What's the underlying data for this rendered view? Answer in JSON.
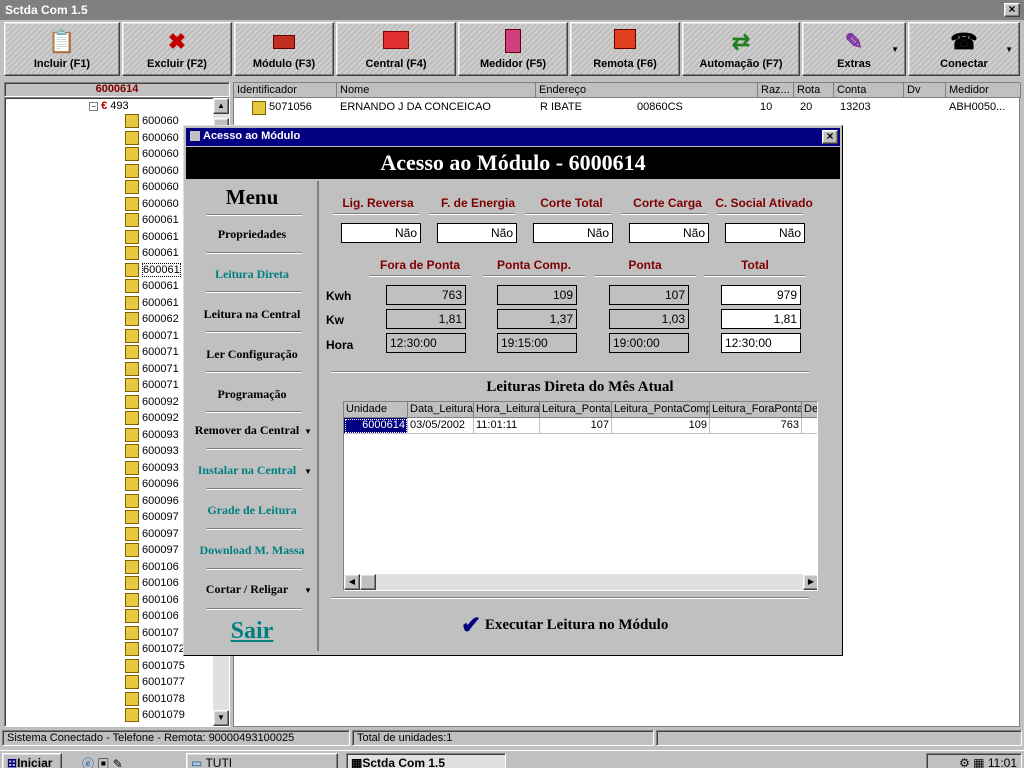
{
  "window": {
    "title": "Sctda Com 1.5",
    "close": "×"
  },
  "toolbar": [
    {
      "label": "Incluir (F1)",
      "icon": "clipboard-icon"
    },
    {
      "label": "Excluir (F2)",
      "icon": "red-x-icon"
    },
    {
      "label": "Módulo (F3)",
      "icon": "module-icon"
    },
    {
      "label": "Central (F4)",
      "icon": "central-icon"
    },
    {
      "label": "Medidor (F5)",
      "icon": "meter-icon"
    },
    {
      "label": "Remota (F6)",
      "icon": "remote-icon"
    },
    {
      "label": "Automação (F7)",
      "icon": "automation-icon"
    },
    {
      "label": "Extras",
      "icon": "extras-icon"
    },
    {
      "label": "Conectar",
      "icon": "phone-icon"
    }
  ],
  "tree": {
    "header": "6000614",
    "root": "493",
    "items": [
      "600060",
      "600060",
      "600060",
      "600060",
      "600060",
      "600060",
      "600061",
      "600061",
      "600061",
      "600061",
      "600061",
      "600061",
      "600062",
      "600071",
      "600071",
      "600071",
      "600071",
      "600092",
      "600092",
      "600093",
      "600093",
      "600093",
      "600096",
      "600096",
      "600097",
      "600097",
      "600097",
      "600106",
      "600106",
      "600106",
      "600106",
      "600107",
      "6001072",
      "6001075",
      "6001077",
      "6001078",
      "6001079"
    ]
  },
  "grid": {
    "columns": [
      "Identificador",
      "Nome",
      "Endereço",
      "Raz...",
      "Rota",
      "Conta",
      "Dv",
      "Medidor"
    ],
    "row": {
      "id": "5071056",
      "nome": "ERNANDO J DA CONCEICAO",
      "endereco": "R IBATE",
      "endereco2": "00860CS",
      "raz": "10",
      "rota": "20",
      "conta": "13203",
      "dv": "",
      "medidor": "ABH0050..."
    }
  },
  "dialog": {
    "title": "Acesso ao Módulo",
    "header": "Acesso ao Módulo - 6000614",
    "menu": {
      "title": "Menu",
      "items": [
        "Propriedades",
        "Leitura Direta",
        "Leitura na Central",
        "Ler Configuração",
        "Programação",
        "Remover da Central",
        "Instalar na Central",
        "Grade de Leitura",
        "Download M. Massa",
        "Cortar / Religar",
        "Sair"
      ]
    },
    "flags": {
      "labels": [
        "Lig. Reversa",
        "F. de Energia",
        "Corte Total",
        "Corte Carga",
        "C. Social Ativado"
      ],
      "values": [
        "Não",
        "Não",
        "Não",
        "Não",
        "Não"
      ]
    },
    "readings": {
      "columns": [
        "Fora de Ponta",
        "Ponta Comp.",
        "Ponta",
        "Total"
      ],
      "rows": [
        {
          "label": "Kwh",
          "values": [
            "763",
            "109",
            "107",
            "979"
          ]
        },
        {
          "label": "Kw",
          "values": [
            "1,81",
            "1,37",
            "1,03",
            "1,81"
          ]
        },
        {
          "label": "Hora",
          "values": [
            "12:30:00",
            "19:15:00",
            "19:00:00",
            "12:30:00"
          ]
        }
      ]
    },
    "table": {
      "title": "Leituras Direta do Mês Atual",
      "columns": [
        "Unidade",
        "Data_Leitura",
        "Hora_Leitura",
        "Leitura_Ponta",
        "Leitura_PontaComp",
        "Leitura_ForaPonta",
        "De"
      ],
      "rows": [
        [
          "6000614",
          "03/05/2002",
          "11:01:11",
          "107",
          "109",
          "763",
          ""
        ]
      ]
    },
    "execute": "Executar Leitura no Módulo"
  },
  "status": {
    "left": "Sistema Conectado - Telefone - Remota: 90000493100025",
    "right": "Total de unidades:1"
  },
  "taskbar": {
    "start": "Iniciar",
    "task1": "TUTI",
    "task2": "Sctda Com 1.5",
    "clock": "11:01"
  }
}
